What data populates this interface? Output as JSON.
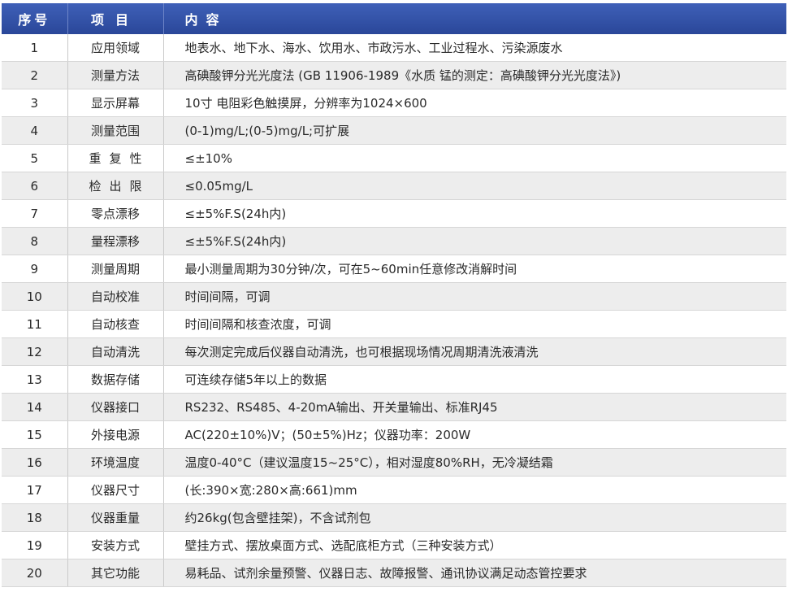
{
  "header": {
    "no": "序号",
    "item": "项目",
    "content": "内容"
  },
  "rows": [
    {
      "no": "1",
      "item": "应用领域",
      "content": "地表水、地下水、海水、饮用水、市政污水、工业过程水、污染源废水"
    },
    {
      "no": "2",
      "item": "测量方法",
      "content": "高碘酸钾分光光度法 (GB 11906-1989《水质  锰的测定：高碘酸钾分光光度法》)"
    },
    {
      "no": "3",
      "item": "显示屏幕",
      "content": "10寸 电阻彩色触摸屏，分辨率为1024×600"
    },
    {
      "no": "4",
      "item": "测量范围",
      "content": "(0-1)mg/L;(0-5)mg/L;可扩展"
    },
    {
      "no": "5",
      "item": "重复性",
      "content": "≤±10%"
    },
    {
      "no": "6",
      "item": "检出限",
      "content": "≤0.05mg/L"
    },
    {
      "no": "7",
      "item": "零点漂移",
      "content": "≤±5%F.S(24h内)"
    },
    {
      "no": "8",
      "item": "量程漂移",
      "content": "≤±5%F.S(24h内)"
    },
    {
      "no": "9",
      "item": "测量周期",
      "content": "最小测量周期为30分钟/次，可在5~60min任意修改消解时间"
    },
    {
      "no": "10",
      "item": "自动校准",
      "content": "时间间隔，可调"
    },
    {
      "no": "11",
      "item": "自动核查",
      "content": "时间间隔和核查浓度，可调"
    },
    {
      "no": "12",
      "item": "自动清洗",
      "content": "每次测定完成后仪器自动清洗，也可根据现场情况周期清洗液清洗"
    },
    {
      "no": "13",
      "item": "数据存储",
      "content": "可连续存储5年以上的数据"
    },
    {
      "no": "14",
      "item": "仪器接口",
      "content": "RS232、RS485、4-20mA输出、开关量输出、标准RJ45"
    },
    {
      "no": "15",
      "item": "外接电源",
      "content": "AC(220±10%)V；(50±5%)Hz；仪器功率：200W"
    },
    {
      "no": "16",
      "item": "环境温度",
      "content": "温度0-40°C（建议温度15~25°C），相对湿度80%RH，无冷凝结霜"
    },
    {
      "no": "17",
      "item": "仪器尺寸",
      "content": "(长:390×宽:280×高:661)mm"
    },
    {
      "no": "18",
      "item": "仪器重量",
      "content": "约26kg(包含壁挂架)，不含试剂包"
    },
    {
      "no": "19",
      "item": "安装方式",
      "content": "壁挂方式、摆放桌面方式、选配底柜方式（三种安装方式）"
    },
    {
      "no": "20",
      "item": "其它功能",
      "content": "易耗品、试剂余量预警、仪器日志、故障报警、通讯协议满足动态管控要求"
    }
  ]
}
